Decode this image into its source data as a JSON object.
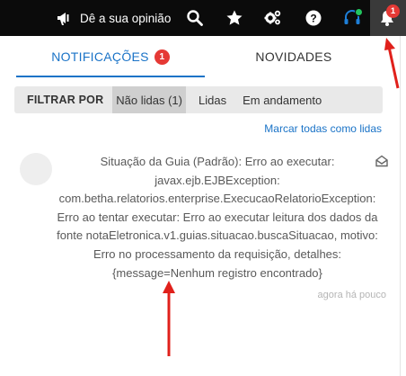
{
  "topbar": {
    "feedback_label": "Dê a sua opinião",
    "notification_count": "1",
    "icons": [
      "megaphone-icon",
      "search-icon",
      "star-icon",
      "settings-icon",
      "help-icon",
      "headset-icon",
      "bell-icon"
    ],
    "colors": {
      "background": "#0b0b0b",
      "badge": "#e53935",
      "status_dot": "#22c55e"
    }
  },
  "panel": {
    "tabs": [
      {
        "label": "NOTIFICAÇÕES",
        "badge": "1",
        "active": true
      },
      {
        "label": "NOVIDADES",
        "active": false
      }
    ],
    "filter": {
      "label": "FILTRAR POR",
      "options": [
        {
          "label": "Não lidas (1)",
          "selected": true
        },
        {
          "label": "Lidas",
          "selected": false
        },
        {
          "label": "Em andamento",
          "selected": false
        }
      ]
    },
    "mark_all_label": "Marcar todas como lidas",
    "notifications": [
      {
        "lines": [
          "Situação da Guia (Padrão): Erro ao executar:",
          "javax.ejb.EJBException:",
          "com.betha.relatorios.enterprise.ExecucaoRelatorioException:",
          "Erro ao tentar executar: Erro ao executar leitura dos dados da",
          "fonte notaEletronica.v1.guias.situacao.buscaSituacao, motivo:",
          "Erro no processamento da requisição, detalhes:",
          "{message=Nenhum registro encontrado}"
        ],
        "time": "agora há pouco",
        "icon": "envelope-open-icon"
      }
    ],
    "accent_color": "#1a73c7"
  },
  "annotations": {
    "arrow_color": "#e0201b"
  }
}
